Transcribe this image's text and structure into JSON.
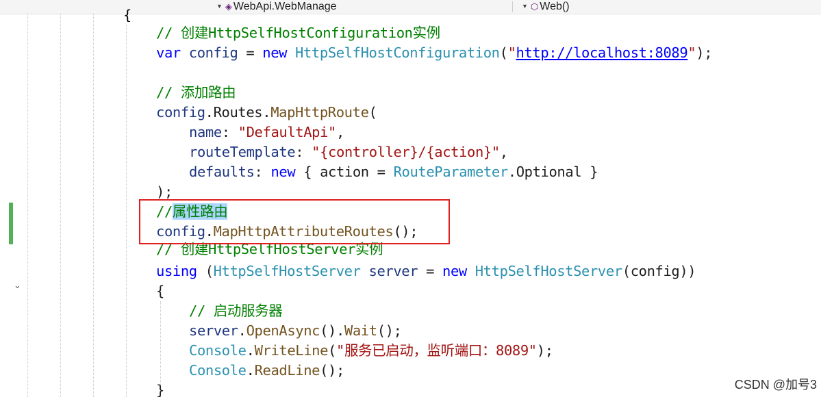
{
  "nav": {
    "class_dropdown": "WebApi.WebManage",
    "member_dropdown": "Web()",
    "class_icon": "class-icon",
    "member_icon": "method-cube-icon"
  },
  "code": {
    "top_brace": "{",
    "comment_config": "// 创建HttpSelfHostConfiguration实例",
    "kw_var": "var",
    "var_config": "config",
    "op_eq": " = ",
    "kw_new": "new",
    "type_config": "HttpSelfHostConfiguration",
    "str_quote_open": "\"",
    "url": "http://localhost:8089",
    "str_quote_close": "\"",
    "end_paren": ");",
    "comment_route": "// 添加路由",
    "routes_obj": "config",
    "routes_prop": ".Routes.",
    "map_route": "MapHttpRoute",
    "open_paren": "(",
    "param_name": "name",
    "val_name": "\"DefaultApi\"",
    "param_template": "routeTemplate",
    "val_template": "\"{controller}/{action}\"",
    "param_defaults": "defaults",
    "defaults_open": " { action = ",
    "type_routeparam": "RouteParameter",
    "optional": ".Optional }",
    "close_stmt": ");",
    "comment_attr_prefix": "//",
    "comment_attr_selected": "属性路由",
    "attr_obj": "config",
    "attr_method": "MapHttpAttributeRoutes",
    "attr_call": "();",
    "comment_server": "// 创建HttpSelfHostServer实例",
    "kw_using": "using",
    "type_server": "HttpSelfHostServer",
    "var_server": "server",
    "server_args": "(config))",
    "open_brace": "{",
    "comment_start": "// 启动服务器",
    "server_obj": "server",
    "open_async": "OpenAsync",
    "wait": "Wait",
    "type_console": "Console",
    "writeline": "WriteLine",
    "writeline_str": "\"服务已启动，监听端口：8089\"",
    "readline": "ReadLine",
    "close_brace": "}"
  },
  "watermark": "CSDN @加号3"
}
